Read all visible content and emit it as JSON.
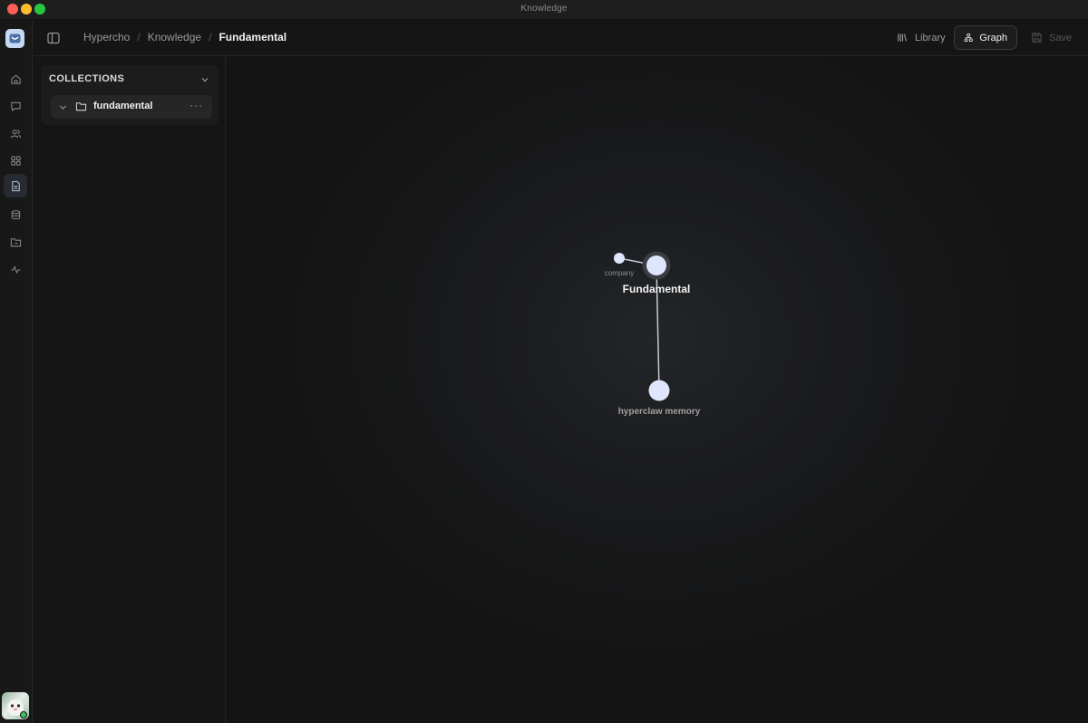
{
  "window": {
    "title": "Knowledge"
  },
  "rail": {
    "items": [
      {
        "icon": "home-icon",
        "active": false
      },
      {
        "icon": "chat-icon",
        "active": false
      },
      {
        "icon": "users-icon",
        "active": false
      },
      {
        "icon": "apps-grid-icon",
        "active": false
      },
      {
        "icon": "document-icon",
        "active": true
      },
      {
        "icon": "database-icon",
        "active": false
      },
      {
        "icon": "folder-icon",
        "active": false
      },
      {
        "icon": "activity-icon",
        "active": false
      }
    ]
  },
  "header": {
    "breadcrumbs": [
      "Hypercho",
      "Knowledge",
      "Fundamental"
    ],
    "separator": "/",
    "library_label": "Library",
    "graph_label": "Graph",
    "save_label": "Save"
  },
  "collections": {
    "title": "COLLECTIONS",
    "folders": [
      {
        "name": "fundamental",
        "more": "···"
      }
    ]
  },
  "graph": {
    "nodes": [
      {
        "id": "company",
        "label": "company"
      },
      {
        "id": "fundamental",
        "label": "Fundamental"
      },
      {
        "id": "memory",
        "label": "hyperclaw memory"
      }
    ],
    "edges": [
      [
        "company",
        "fundamental"
      ],
      [
        "fundamental",
        "memory"
      ]
    ]
  },
  "colors": {
    "node": "#dfe6fb",
    "edge": "#c3c9d6",
    "accent_logo": "#c6d9f2"
  }
}
